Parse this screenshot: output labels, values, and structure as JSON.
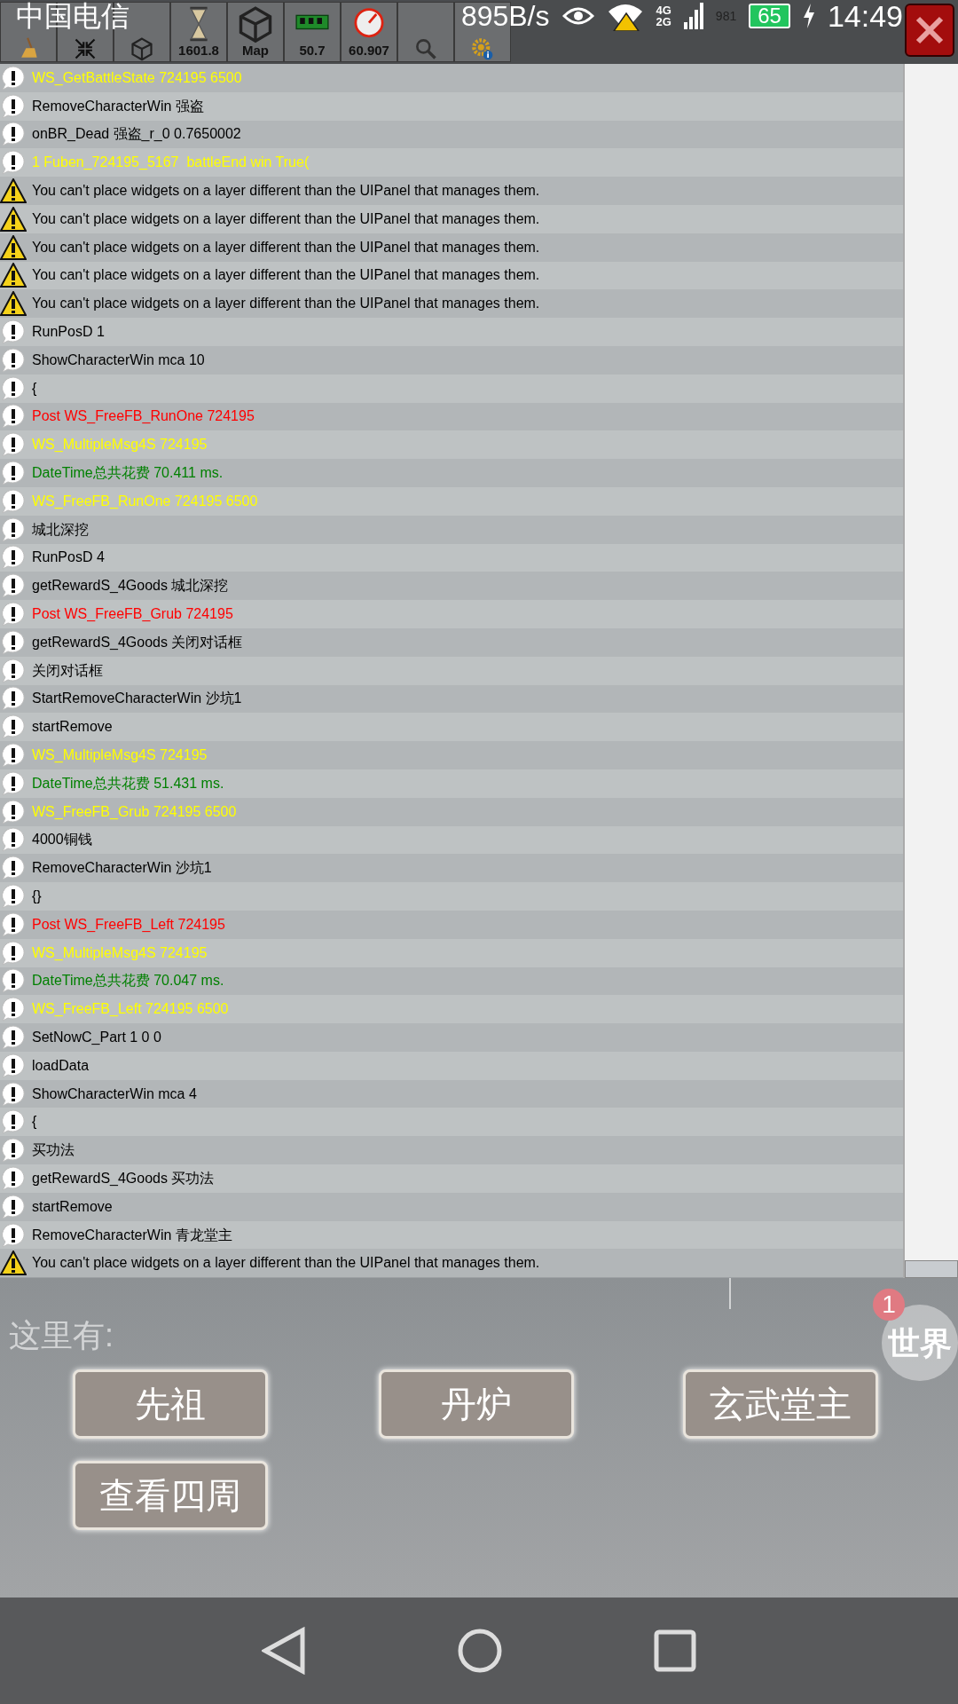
{
  "status_bar": {
    "carrier": "中国电信",
    "net_speed": "895B/s",
    "network_labels": [
      "4G",
      "2G"
    ],
    "signal_text": "981",
    "battery": "65",
    "time": "14:49"
  },
  "toolbar": [
    {
      "kind": "broom"
    },
    {
      "kind": "collapse"
    },
    {
      "kind": "unity"
    },
    {
      "kind": "hourglass",
      "label": "1601.8"
    },
    {
      "kind": "unity",
      "label": "Map"
    },
    {
      "kind": "memory",
      "label": "50.7"
    },
    {
      "kind": "gauge",
      "label": "60.907"
    },
    {
      "kind": "search"
    },
    {
      "kind": "settings"
    }
  ],
  "log": [
    {
      "kind": "info",
      "text": "WS_GetBattleState 724195 6500",
      "color": "#ffff00"
    },
    {
      "kind": "info",
      "text": "RemoveCharacterWin 强盗",
      "color": "#000000"
    },
    {
      "kind": "info",
      "text": "onBR_Dead 强盗_r_0 0.7650002",
      "color": "#000000"
    },
    {
      "kind": "info",
      "text": "1 Fuben_724195_5167  battleEnd win True(",
      "color": "#ffff00"
    },
    {
      "kind": "warning",
      "text": "You can't place widgets on a layer different than the UIPanel that manages them.",
      "color": "#000000"
    },
    {
      "kind": "warning",
      "text": "You can't place widgets on a layer different than the UIPanel that manages them.",
      "color": "#000000"
    },
    {
      "kind": "warning",
      "text": "You can't place widgets on a layer different than the UIPanel that manages them.",
      "color": "#000000"
    },
    {
      "kind": "warning",
      "text": "You can't place widgets on a layer different than the UIPanel that manages them.",
      "color": "#000000"
    },
    {
      "kind": "warning",
      "text": "You can't place widgets on a layer different than the UIPanel that manages them.",
      "color": "#000000"
    },
    {
      "kind": "info",
      "text": "RunPosD 1",
      "color": "#000000"
    },
    {
      "kind": "info",
      "text": "ShowCharacterWin mca 10",
      "color": "#000000"
    },
    {
      "kind": "info",
      "text": "{",
      "color": "#000000"
    },
    {
      "kind": "info",
      "text": "Post WS_FreeFB_RunOne 724195",
      "color": "#ff0000"
    },
    {
      "kind": "info",
      "text": "WS_MultipleMsg4S 724195",
      "color": "#ffff00"
    },
    {
      "kind": "info",
      "text": "DateTime总共花费 70.411 ms.",
      "color": "#008000"
    },
    {
      "kind": "info",
      "text": "WS_FreeFB_RunOne 724195 6500",
      "color": "#ffff00"
    },
    {
      "kind": "info",
      "text": "城北深挖",
      "color": "#000000"
    },
    {
      "kind": "info",
      "text": "RunPosD 4",
      "color": "#000000"
    },
    {
      "kind": "info",
      "text": "getRewardS_4Goods 城北深挖",
      "color": "#000000"
    },
    {
      "kind": "info",
      "text": "Post WS_FreeFB_Grub 724195",
      "color": "#ff0000"
    },
    {
      "kind": "info",
      "text": "getRewardS_4Goods 关闭对话框",
      "color": "#000000"
    },
    {
      "kind": "info",
      "text": "关闭对话框",
      "color": "#000000"
    },
    {
      "kind": "info",
      "text": "StartRemoveCharacterWin 沙坑1",
      "color": "#000000"
    },
    {
      "kind": "info",
      "text": "startRemove",
      "color": "#000000"
    },
    {
      "kind": "info",
      "text": "WS_MultipleMsg4S 724195",
      "color": "#ffff00"
    },
    {
      "kind": "info",
      "text": "DateTime总共花费 51.431 ms.",
      "color": "#008000"
    },
    {
      "kind": "info",
      "text": "WS_FreeFB_Grub 724195 6500",
      "color": "#ffff00"
    },
    {
      "kind": "info",
      "text": "4000铜钱",
      "color": "#000000"
    },
    {
      "kind": "info",
      "text": "RemoveCharacterWin 沙坑1",
      "color": "#000000"
    },
    {
      "kind": "info",
      "text": "{}",
      "color": "#000000"
    },
    {
      "kind": "info",
      "text": "Post WS_FreeFB_Left 724195",
      "color": "#ff0000"
    },
    {
      "kind": "info",
      "text": "WS_MultipleMsg4S 724195",
      "color": "#ffff00"
    },
    {
      "kind": "info",
      "text": "DateTime总共花费 70.047 ms.",
      "color": "#008000"
    },
    {
      "kind": "info",
      "text": "WS_FreeFB_Left 724195 6500",
      "color": "#ffff00"
    },
    {
      "kind": "info",
      "text": "SetNowC_Part 1 0 0",
      "color": "#000000"
    },
    {
      "kind": "info",
      "text": "loadData",
      "color": "#000000"
    },
    {
      "kind": "info",
      "text": "ShowCharacterWin mca 4",
      "color": "#000000"
    },
    {
      "kind": "info",
      "text": "{",
      "color": "#000000"
    },
    {
      "kind": "info",
      "text": "买功法",
      "color": "#000000"
    },
    {
      "kind": "info",
      "text": "getRewardS_4Goods 买功法",
      "color": "#000000"
    },
    {
      "kind": "info",
      "text": "startRemove",
      "color": "#000000"
    },
    {
      "kind": "info",
      "text": "RemoveCharacterWin 青龙堂主",
      "color": "#000000"
    },
    {
      "kind": "warning",
      "text": "You can't place widgets on a layer different than the UIPanel that manages them.",
      "color": "#000000"
    }
  ],
  "panel": {
    "heading": "这里有:",
    "buttons": [
      "先祖",
      "丹炉",
      "玄武堂主",
      "查看四周"
    ]
  },
  "world": {
    "badge": "1",
    "label": "世界"
  }
}
